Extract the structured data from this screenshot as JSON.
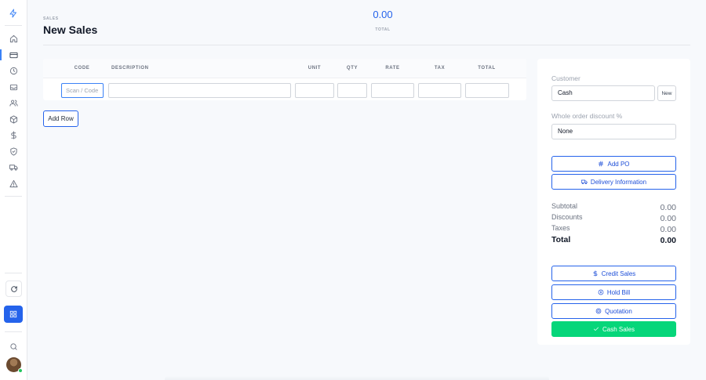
{
  "header": {
    "section": "SALES",
    "title": "New Sales",
    "total_value": "0.00",
    "total_label": "TOTAL"
  },
  "sidebar": {
    "items": [
      {
        "icon": "home-icon"
      },
      {
        "icon": "credit-card-icon",
        "active": true
      },
      {
        "icon": "clock-icon"
      },
      {
        "icon": "inbox-icon"
      },
      {
        "icon": "users-icon"
      },
      {
        "icon": "box-icon"
      },
      {
        "icon": "dollar-icon"
      },
      {
        "icon": "shield-icon"
      },
      {
        "icon": "truck-icon"
      },
      {
        "icon": "alert-triangle-icon"
      }
    ],
    "bottom": [
      "refresh-icon",
      "grid-icon",
      "search-icon",
      "avatar"
    ]
  },
  "table": {
    "columns": [
      "CODE",
      "DESCRIPTION",
      "UNIT",
      "QTY",
      "RATE",
      "TAX",
      "TOTAL"
    ],
    "code_placeholder": "Scan / Code",
    "add_row_label": "Add Row"
  },
  "panel": {
    "customer_label": "Customer",
    "customer_value": "Cash",
    "new_label": "New",
    "discount_label": "Whole order discount %",
    "discount_value": "None",
    "add_po_label": "Add PO",
    "delivery_label": "Delivery Information",
    "summary": {
      "subtotal_label": "Subtotal",
      "subtotal_value": "0.00",
      "discounts_label": "Discounts",
      "discounts_value": "0.00",
      "taxes_label": "Taxes",
      "taxes_value": "0.00",
      "total_label": "Total",
      "total_value": "0.00"
    },
    "credit_sales_label": "Credit Sales",
    "hold_bill_label": "Hold Bill",
    "quotation_label": "Quotation",
    "cash_sales_label": "Cash Sales"
  },
  "colors": {
    "accent": "#2563eb",
    "success": "#06d67a",
    "muted": "#9ca3af"
  }
}
